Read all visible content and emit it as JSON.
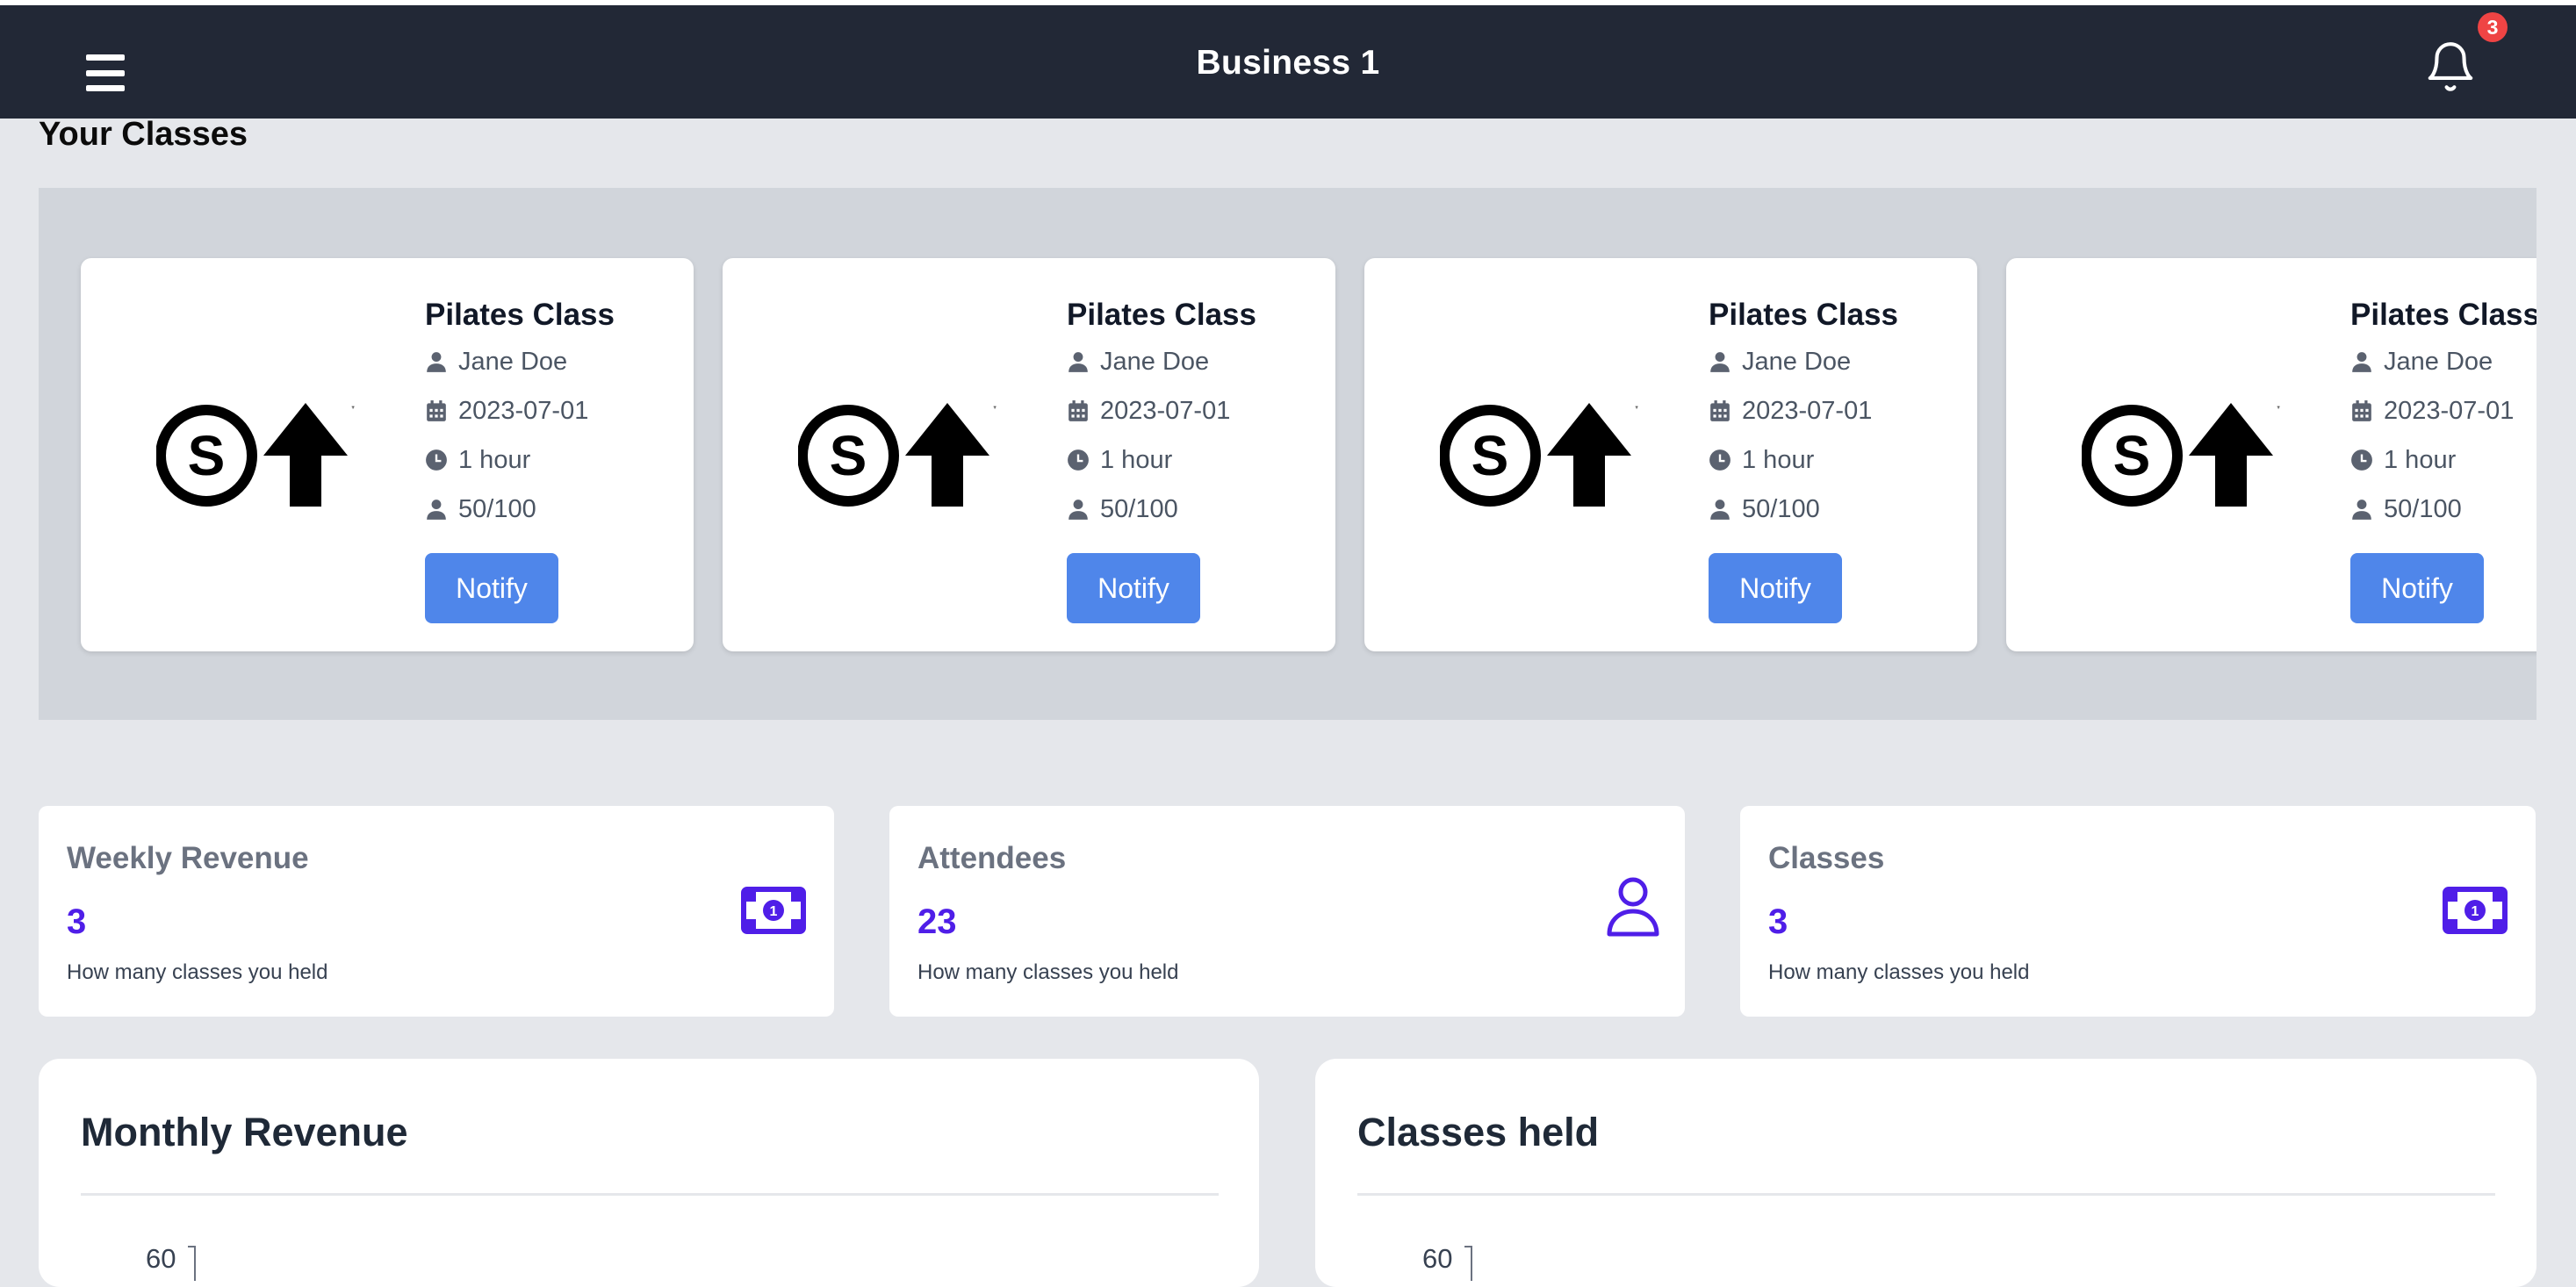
{
  "header": {
    "title": "Business 1",
    "notification_count": "3"
  },
  "classes_section": {
    "title": "Your Classes",
    "cards": [
      {
        "name": "Pilates Class",
        "instructor": "Jane Doe",
        "date": "2023-07-01",
        "duration": "1 hour",
        "capacity": "50/100",
        "button": "Notify"
      },
      {
        "name": "Pilates Class",
        "instructor": "Jane Doe",
        "date": "2023-07-01",
        "duration": "1 hour",
        "capacity": "50/100",
        "button": "Notify"
      },
      {
        "name": "Pilates Class",
        "instructor": "Jane Doe",
        "date": "2023-07-01",
        "duration": "1 hour",
        "capacity": "50/100",
        "button": "Notify"
      },
      {
        "name": "Pilates Class",
        "instructor": "Jane Doe",
        "date": "2023-07-01",
        "duration": "1 hour",
        "capacity": "50/100",
        "button": "Notify"
      }
    ]
  },
  "stats": [
    {
      "label": "Weekly Revenue",
      "value": "3",
      "description": "How many classes you held",
      "icon": "money-bill-icon"
    },
    {
      "label": "Attendees",
      "value": "23",
      "description": "How many classes you held",
      "icon": "user-icon"
    },
    {
      "label": "Classes",
      "value": "3",
      "description": "How many classes you held",
      "icon": "money-bill-icon"
    }
  ],
  "charts": [
    {
      "title": "Monthly Revenue",
      "y_tick_top": "60"
    },
    {
      "title": "Classes held",
      "y_tick_top": "60"
    }
  ],
  "colors": {
    "header_bg": "#222836",
    "accent": "#4f86ea",
    "stat_value": "#4f1ee8",
    "badge": "#ef4444"
  }
}
